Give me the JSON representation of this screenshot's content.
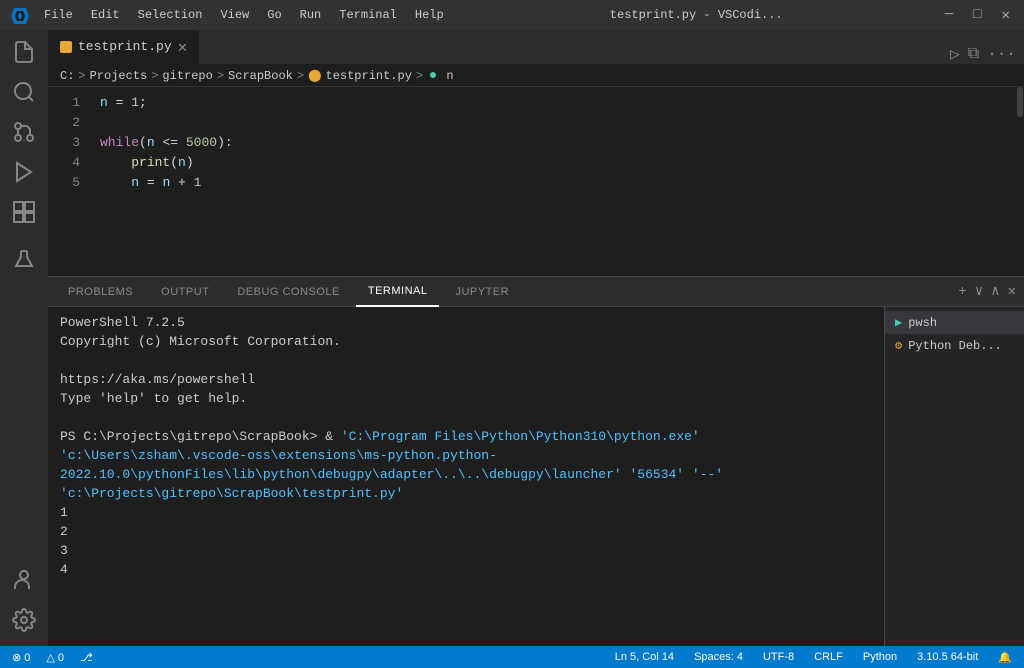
{
  "titlebar": {
    "logo": "⬡",
    "menu_items": [
      "File",
      "Edit",
      "Selection",
      "View",
      "Go",
      "Run",
      "Terminal",
      "Help"
    ],
    "title": "testprint.py - VSCodi...",
    "btn_run": "▷",
    "btn_split": "⧉",
    "btn_layout": "⊞",
    "btn_more": "···",
    "btn_minimize": "─",
    "btn_maximize": "□",
    "btn_close": "✕"
  },
  "tab": {
    "icon_color": "#e8a838",
    "label": "testprint.py",
    "close": "✕"
  },
  "breadcrumb": {
    "parts": [
      "C:",
      "Projects",
      "gitrepo",
      "ScrapBook",
      "testprint.py",
      "n"
    ],
    "separators": [
      ">",
      ">",
      ">",
      ">",
      ">"
    ]
  },
  "code": {
    "lines": [
      {
        "num": 1,
        "content": "n = 1;"
      },
      {
        "num": 2,
        "content": ""
      },
      {
        "num": 3,
        "content": "while(n <= 5000):"
      },
      {
        "num": 4,
        "content": "    print(n)"
      },
      {
        "num": 5,
        "content": "    n = n + 1"
      }
    ]
  },
  "panel": {
    "tabs": [
      "PROBLEMS",
      "OUTPUT",
      "DEBUG CONSOLE",
      "TERMINAL",
      "JUPYTER"
    ],
    "active_tab": "TERMINAL",
    "btn_add": "+",
    "btn_chevron_down": "∨",
    "btn_chevron_up": "∧",
    "btn_close": "✕"
  },
  "terminal": {
    "lines": [
      {
        "type": "normal",
        "text": "PowerShell 7.2.5"
      },
      {
        "type": "normal",
        "text": "Copyright (c) Microsoft Corporation."
      },
      {
        "type": "normal",
        "text": ""
      },
      {
        "type": "normal",
        "text": "https://aka.ms/powershell"
      },
      {
        "type": "normal",
        "text": "Type 'help' to get help."
      },
      {
        "type": "normal",
        "text": ""
      },
      {
        "type": "prompt",
        "prompt": "PS C:\\Projects\\gitrepo\\ScrapBook> ",
        "cmd_start": "& ",
        "cmd": "'C:\\Program Files\\Python\\Python310\\python.exe' 'c:\\Users\\zsham\\.vscode-oss\\extensions\\ms-python.python-2022.10.0\\pythonFiles\\lib\\python\\debugpy\\adapter\\..\\..\\debugpy\\launcher' '56534' '--' 'c:\\Projects\\gitrepo\\ScrapBook\\testprint.py'"
      },
      {
        "type": "output",
        "text": "1"
      },
      {
        "type": "output",
        "text": "2"
      },
      {
        "type": "output",
        "text": "3"
      },
      {
        "type": "output",
        "text": "4"
      }
    ],
    "terminals": [
      {
        "label": "pwsh",
        "icon": "▶",
        "active": true
      },
      {
        "label": "Python Deb...",
        "icon": "⚙",
        "active": false
      }
    ]
  },
  "statusbar": {
    "errors": "⊗ 0",
    "warnings": "△ 0",
    "branch_icon": "⎇",
    "branch": "",
    "ln_col": "Ln 5, Col 14",
    "spaces": "Spaces: 4",
    "encoding": "UTF-8",
    "line_ending": "CRLF",
    "language": "Python",
    "version": "3.10.5 64-bit",
    "bell": "🔔"
  }
}
